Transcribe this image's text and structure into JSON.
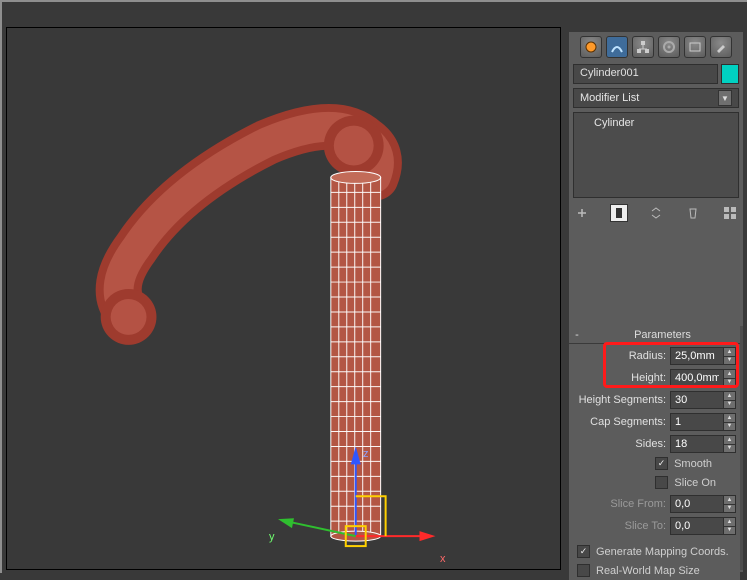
{
  "object": {
    "name": "Cylinder001"
  },
  "modifier_list": {
    "label": "Modifier List"
  },
  "stack": {
    "items": [
      "Cylinder"
    ]
  },
  "rollout": {
    "title": "Parameters"
  },
  "params": {
    "radius_label": "Radius:",
    "radius_value": "25,0mm",
    "height_label": "Height:",
    "height_value": "400,0mm",
    "height_segments_label": "Height Segments:",
    "height_segments_value": "30",
    "cap_segments_label": "Cap Segments:",
    "cap_segments_value": "1",
    "sides_label": "Sides:",
    "sides_value": "18",
    "smooth_label": "Smooth",
    "smooth_checked": true,
    "slice_on_label": "Slice On",
    "slice_on_checked": false,
    "slice_from_label": "Slice From:",
    "slice_from_value": "0,0",
    "slice_to_label": "Slice To:",
    "slice_to_value": "0,0",
    "gen_map_label": "Generate Mapping Coords.",
    "gen_map_checked": true,
    "real_world_label": "Real-World Map Size",
    "real_world_checked": false
  },
  "axes": {
    "x": "x",
    "y": "y",
    "z": "z"
  }
}
